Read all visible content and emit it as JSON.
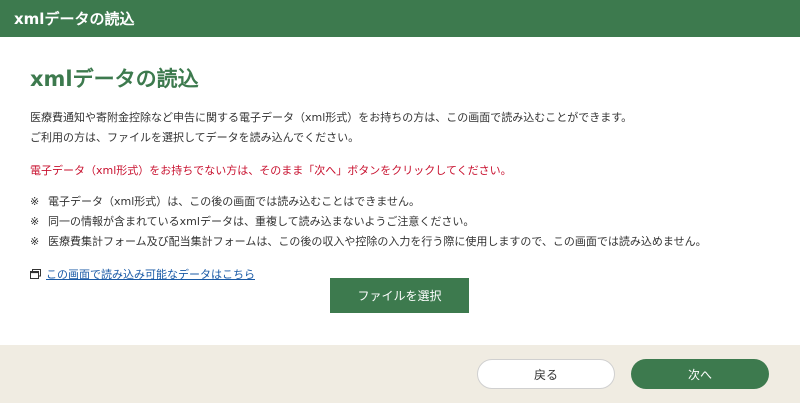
{
  "header": {
    "title": "xmlデータの読込"
  },
  "main": {
    "title": "xmlデータの読込",
    "description": [
      "医療費通知や寄附金控除など申告に関する電子データ（xml形式）をお持ちの方は、この画面で読み込むことができます。",
      "ご利用の方は、ファイルを選択してデータを読み込んでください。"
    ],
    "warning": "電子データ（xml形式）をお持ちでない方は、そのまま「次へ」ボタンをクリックしてください。",
    "note_mark": "※",
    "notes": [
      "電子データ（xml形式）は、この後の画面では読み込むことはできません。",
      "同一の情報が含まれているxmlデータは、重複して読み込まないようご注意ください。",
      "医療費集計フォーム及び配当集計フォームは、この後の収入や控除の入力を行う際に使用しますので、この画面では読み込めません。"
    ],
    "link_text": "この画面で読み込み可能なデータはこちら",
    "file_button": "ファイルを選択"
  },
  "footer": {
    "back_label": "戻る",
    "next_label": "次へ"
  },
  "colors": {
    "brand_green": "#3d7a4e",
    "warning_red": "#c8102e",
    "link_blue": "#1a5aa6",
    "footer_bg": "#f0ece2"
  },
  "icons": {
    "link": "external-window-icon"
  }
}
